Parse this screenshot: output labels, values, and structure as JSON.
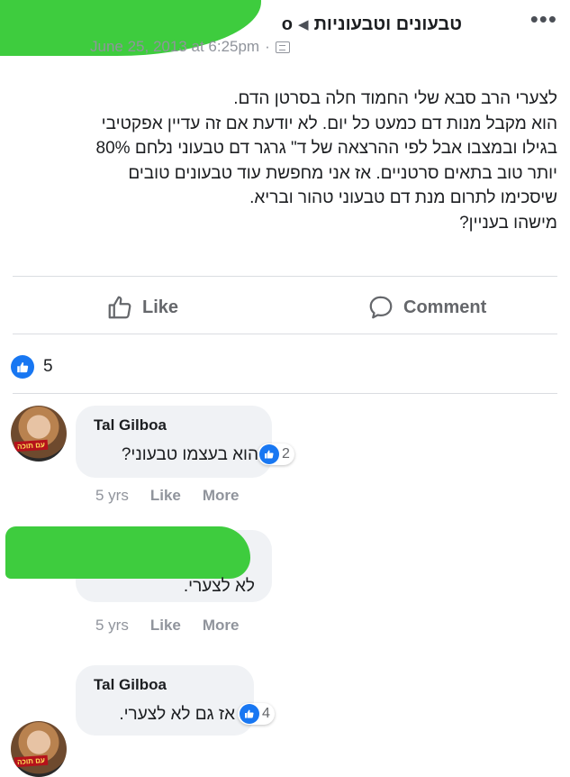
{
  "post": {
    "group_name": "טבעונים וטבעוניות",
    "poster_fragment": "o",
    "date": "June 25, 2013 at 6:25pm",
    "body_lines": [
      "לצערי הרב סבא שלי החמוד חלה בסרטן הדם.",
      "הוא מקבל מנות דם כמעט כל יום. לא יודעת אם זה עדיין אפקטיבי",
      "בגילו ובמצבו אבל לפי ההרצאה של ד\" גרגר דם טבעוני נלחם 80%",
      "יותר טוב בתאים סרטניים. אז אני מחפשת עוד טבעונים טובים",
      "שיסכימו לתרום מנת דם טבעוני טהור ובריא.",
      "מישהו בעניין?"
    ]
  },
  "actions": {
    "like_label": "Like",
    "comment_label": "Comment"
  },
  "reactions": {
    "count": "5"
  },
  "comments": [
    {
      "author": "Tal Gilboa",
      "text": "הוא בעצמו טבעוני?",
      "likes": "2",
      "age": "5 yrs",
      "like_label": "Like",
      "more_label": "More",
      "avatar_banner": "עם תוכה"
    },
    {
      "author": "",
      "text": "לא לצערי.",
      "age": "5 yrs",
      "like_label": "Like",
      "more_label": "More"
    },
    {
      "author": "Tal Gilboa",
      "text": "אז גם לא לצערי.",
      "likes": "4",
      "avatar_banner": "עם תוכה"
    }
  ],
  "colors": {
    "facebook_blue": "#1877f2",
    "redaction_green": "#3ecc3e",
    "bubble_gray": "#f0f2f5"
  },
  "icons": [
    "more-dots-icon",
    "chevron-right-icon",
    "audience-icon",
    "thumbs-up-icon",
    "comment-icon",
    "like-reaction-icon"
  ]
}
